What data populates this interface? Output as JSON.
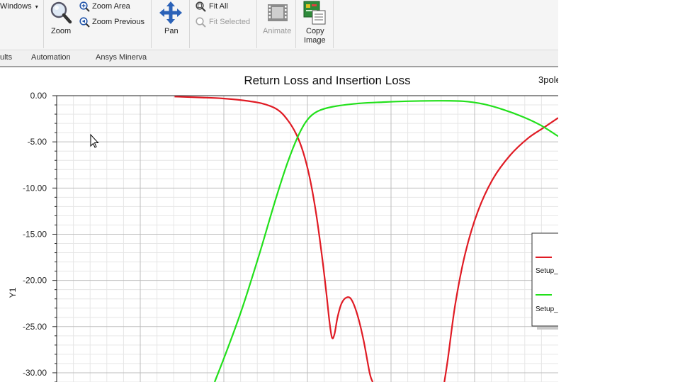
{
  "ribbon": {
    "windows_label": "Windows",
    "zoom_label": "Zoom",
    "zoom_area_label": "Zoom Area",
    "zoom_previous_label": "Zoom Previous",
    "pan_label": "Pan",
    "fit_all_label": "Fit All",
    "fit_selected_label": "Fit Selected",
    "animate_label": "Animate",
    "copy_image_label1": "Copy",
    "copy_image_label2": "Image"
  },
  "tabs": [
    "ults",
    "Automation",
    "Ansys Minerva"
  ],
  "plot": {
    "title": "Return Loss and Insertion Loss",
    "plot_name": "3pole",
    "legend_entries": [
      "Setup_",
      "Setup_"
    ]
  },
  "colors": {
    "return_loss": "#e01b24",
    "insertion_loss": "#22e01b"
  },
  "chart_data": {
    "type": "line",
    "title": "Return Loss and Insertion Loss",
    "ylabel": "Y1",
    "xlabel": "",
    "ylim": [
      -31.0,
      0.0
    ],
    "y_ticks": [
      "0.00",
      "-5.00",
      "-10.00",
      "-15.00",
      "-20.00",
      "-25.00",
      "-30.00"
    ],
    "y_tick_values": [
      0,
      -5,
      -10,
      -15,
      -20,
      -25,
      -30
    ],
    "grid": true,
    "legend_placement": "right",
    "series": [
      {
        "name": "Setup_",
        "color": "#e01b24",
        "points": [
          [
            0.235,
            -0.1
          ],
          [
            0.29,
            -0.2
          ],
          [
            0.33,
            -0.3
          ],
          [
            0.37,
            -0.5
          ],
          [
            0.41,
            -0.85
          ],
          [
            0.44,
            -1.5
          ],
          [
            0.46,
            -2.6
          ],
          [
            0.478,
            -4.2
          ],
          [
            0.492,
            -6.2
          ],
          [
            0.505,
            -9.0
          ],
          [
            0.518,
            -13.0
          ],
          [
            0.53,
            -17.8
          ],
          [
            0.538,
            -21.5
          ],
          [
            0.544,
            -24.5
          ],
          [
            0.549,
            -26.2
          ],
          [
            0.554,
            -25.8
          ],
          [
            0.56,
            -24.0
          ],
          [
            0.568,
            -22.5
          ],
          [
            0.578,
            -21.85
          ],
          [
            0.588,
            -22.1
          ],
          [
            0.6,
            -23.8
          ],
          [
            0.612,
            -26.5
          ],
          [
            0.624,
            -30.0
          ],
          [
            0.63,
            -31.0
          ]
        ]
      },
      {
        "name": "Setup_",
        "color": "#e01b24",
        "points": [
          [
            0.773,
            -31.0
          ],
          [
            0.78,
            -28.5
          ],
          [
            0.795,
            -22.5
          ],
          [
            0.815,
            -17.0
          ],
          [
            0.84,
            -12.5
          ],
          [
            0.87,
            -9.0
          ],
          [
            0.905,
            -6.4
          ],
          [
            0.94,
            -4.6
          ],
          [
            0.97,
            -3.5
          ],
          [
            1.0,
            -2.4
          ]
        ]
      },
      {
        "name": "Setup_",
        "color": "#22e01b",
        "points": [
          [
            0.315,
            -31.0
          ],
          [
            0.34,
            -27.5
          ],
          [
            0.37,
            -23.0
          ],
          [
            0.405,
            -17.0
          ],
          [
            0.435,
            -11.5
          ],
          [
            0.46,
            -7.3
          ],
          [
            0.482,
            -4.3
          ],
          [
            0.5,
            -2.6
          ],
          [
            0.52,
            -1.7
          ],
          [
            0.55,
            -1.2
          ],
          [
            0.6,
            -0.85
          ],
          [
            0.65,
            -0.7
          ],
          [
            0.7,
            -0.6
          ],
          [
            0.76,
            -0.55
          ],
          [
            0.81,
            -0.6
          ],
          [
            0.85,
            -0.9
          ],
          [
            0.89,
            -1.5
          ],
          [
            0.93,
            -2.3
          ],
          [
            0.965,
            -3.2
          ],
          [
            1.0,
            -4.4
          ]
        ]
      }
    ]
  }
}
